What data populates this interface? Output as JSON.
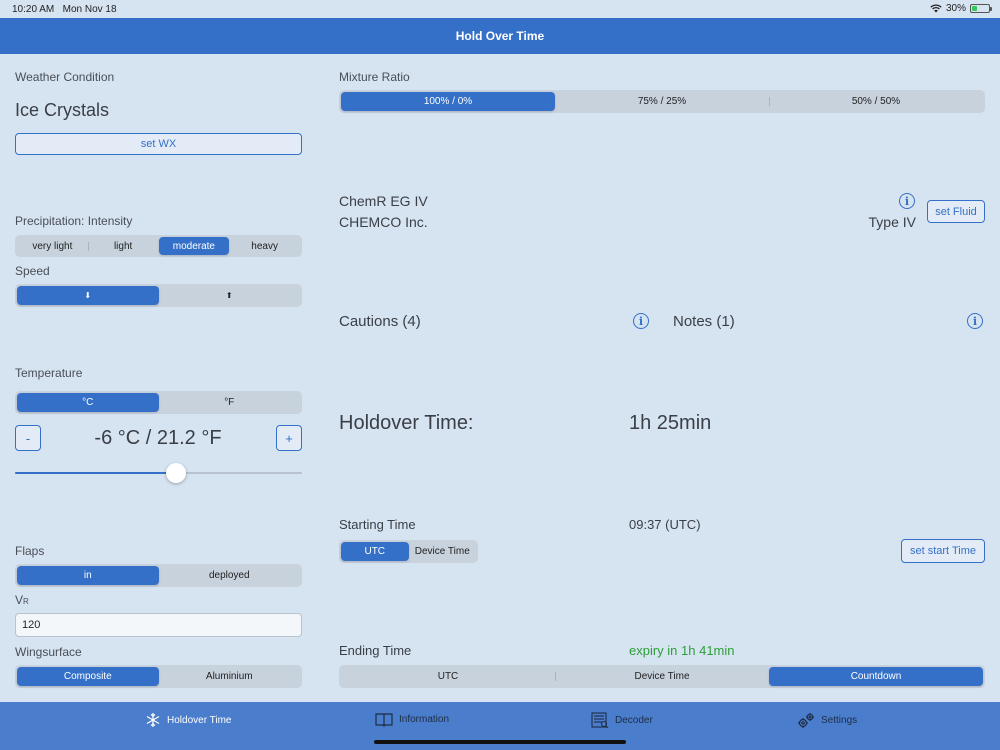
{
  "status": {
    "time": "10:20 AM",
    "date": "Mon Nov 18",
    "battery": "30%",
    "battery_level": 0.3
  },
  "nav": {
    "title": "Hold Over Time"
  },
  "weather": {
    "label": "Weather Condition",
    "value": "Ice Crystals",
    "set_button": "set WX"
  },
  "precip": {
    "label": "Precipitation: Intensity",
    "options": [
      "very light",
      "light",
      "moderate",
      "heavy"
    ],
    "selected": 2
  },
  "speed": {
    "label": "Speed",
    "options": [
      "⬇",
      "⬆"
    ],
    "selected": 0
  },
  "temperature": {
    "label": "Temperature",
    "units": [
      "°C",
      "°F"
    ],
    "selected_unit": 0,
    "minus": "-",
    "plus": "+",
    "value": "-6 °C / 21.2 °F",
    "slider_fraction": 0.56
  },
  "flaps": {
    "label": "Flaps",
    "options": [
      "in",
      "deployed"
    ],
    "selected": 0
  },
  "vr": {
    "label": "V",
    "sub": "R",
    "value": "120"
  },
  "wingsurface": {
    "label": "Wingsurface",
    "options": [
      "Composite",
      "Aluminium"
    ],
    "selected": 0
  },
  "mixture": {
    "label": "Mixture Ratio",
    "options": [
      "100% / 0%",
      "75% / 25%",
      "50% / 50%"
    ],
    "selected": 0
  },
  "fluid": {
    "name": "ChemR EG IV",
    "manufacturer": "CHEMCO Inc.",
    "type": "Type IV",
    "set_button": "set Fluid"
  },
  "cautions": {
    "label": "Cautions (4)"
  },
  "notes": {
    "label": "Notes (1)"
  },
  "holdover": {
    "label": "Holdover Time:",
    "value": "1h 25min"
  },
  "starting": {
    "label": "Starting Time",
    "value": "09:37 (UTC)",
    "options": [
      "UTC",
      "Device Time"
    ],
    "selected": 0,
    "set_button": "set start Time"
  },
  "ending": {
    "label": "Ending Time",
    "value": "expiry in 1h 41min",
    "value_color": "#2e9e3a",
    "options": [
      "UTC",
      "Device Time",
      "Countdown"
    ],
    "selected": 2
  },
  "tabs": [
    {
      "label": "Holdover Time",
      "icon": "snowflake-icon"
    },
    {
      "label": "Information",
      "icon": "book-icon"
    },
    {
      "label": "Decoder",
      "icon": "document-icon"
    },
    {
      "label": "Settings",
      "icon": "gears-icon"
    }
  ],
  "colors": {
    "accent": "#3570c8",
    "background": "#d6e3f0",
    "tabbar": "#4a7dcb"
  }
}
